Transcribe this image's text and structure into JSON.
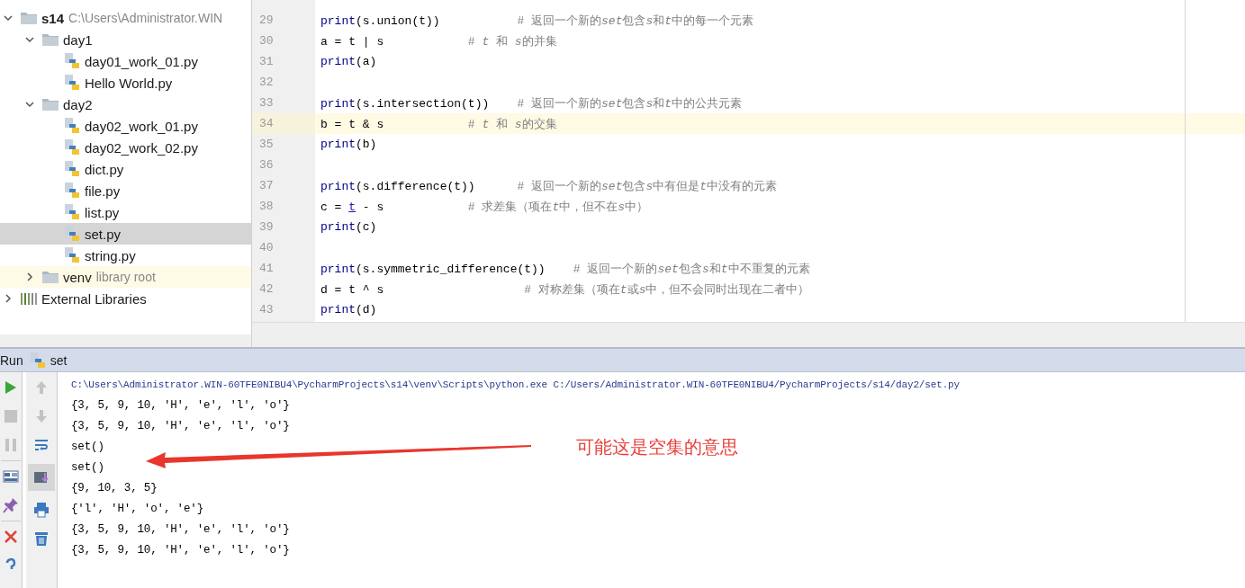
{
  "project_tree": [
    {
      "label": "s14",
      "kind": "folder",
      "bold": true,
      "detail": "C:\\Users\\Administrator.WIN",
      "expanded": true,
      "selected": false,
      "excluded": false,
      "children": [
        {
          "label": "day1",
          "kind": "folder",
          "expanded": true,
          "selected": false,
          "excluded": false,
          "children": [
            {
              "label": "day01_work_01.py",
              "kind": "file",
              "selected": false
            },
            {
              "label": "Hello World.py",
              "kind": "file",
              "selected": false
            }
          ]
        },
        {
          "label": "day2",
          "kind": "folder",
          "expanded": true,
          "selected": false,
          "excluded": false,
          "children": [
            {
              "label": "day02_work_01.py",
              "kind": "file",
              "selected": false
            },
            {
              "label": "day02_work_02.py",
              "kind": "file",
              "selected": false
            },
            {
              "label": "dict.py",
              "kind": "file",
              "selected": false
            },
            {
              "label": "file.py",
              "kind": "file",
              "selected": false
            },
            {
              "label": "list.py",
              "kind": "file",
              "selected": false
            },
            {
              "label": "set.py",
              "kind": "file",
              "selected": true
            },
            {
              "label": "string.py",
              "kind": "file",
              "selected": false
            }
          ]
        },
        {
          "label": "venv",
          "kind": "folder",
          "detail": "library root",
          "expanded": false,
          "selected": false,
          "excluded": true
        }
      ]
    },
    {
      "label": "External Libraries",
      "kind": "library",
      "expanded": false,
      "selected": false,
      "excluded": false
    }
  ],
  "editor": {
    "lines": [
      {
        "number": "29",
        "current": false,
        "tokens": [
          {
            "kind": "builtin",
            "text": "print"
          },
          {
            "kind": "plain",
            "text": "(s.union(t))           "
          },
          {
            "kind": "comment",
            "text": "# 返回一个新的"
          },
          {
            "kind": "comment_var",
            "text": "set"
          },
          {
            "kind": "comment",
            "text": "包含"
          },
          {
            "kind": "comment_var",
            "text": "s"
          },
          {
            "kind": "comment",
            "text": "和"
          },
          {
            "kind": "comment_var",
            "text": "t"
          },
          {
            "kind": "comment",
            "text": "中的每一个元素"
          }
        ]
      },
      {
        "number": "30",
        "current": false,
        "tokens": [
          {
            "kind": "plain",
            "text": "a = t | s            "
          },
          {
            "kind": "comment",
            "text": "# "
          },
          {
            "kind": "comment_var",
            "text": "t"
          },
          {
            "kind": "comment",
            "text": " 和 "
          },
          {
            "kind": "comment_var",
            "text": "s"
          },
          {
            "kind": "comment",
            "text": "的并集"
          }
        ]
      },
      {
        "number": "31",
        "current": false,
        "tokens": [
          {
            "kind": "builtin",
            "text": "print"
          },
          {
            "kind": "plain",
            "text": "(a)"
          }
        ]
      },
      {
        "number": "32",
        "current": false
      },
      {
        "number": "33",
        "current": false,
        "tokens": [
          {
            "kind": "builtin",
            "text": "print"
          },
          {
            "kind": "plain",
            "text": "(s.intersection(t))    "
          },
          {
            "kind": "comment",
            "text": "# 返回一个新的"
          },
          {
            "kind": "comment_var",
            "text": "set"
          },
          {
            "kind": "comment",
            "text": "包含"
          },
          {
            "kind": "comment_var",
            "text": "s"
          },
          {
            "kind": "comment",
            "text": "和"
          },
          {
            "kind": "comment_var",
            "text": "t"
          },
          {
            "kind": "comment",
            "text": "中的公共元素"
          }
        ]
      },
      {
        "number": "34",
        "current": true,
        "tokens": [
          {
            "kind": "plain",
            "text": "b = t & s            "
          },
          {
            "kind": "comment",
            "text": "# "
          },
          {
            "kind": "comment_var",
            "text": "t"
          },
          {
            "kind": "comment",
            "text": " 和 "
          },
          {
            "kind": "comment_var",
            "text": "s"
          },
          {
            "kind": "comment",
            "text": "的交集"
          }
        ]
      },
      {
        "number": "35",
        "current": false,
        "tokens": [
          {
            "kind": "builtin",
            "text": "print"
          },
          {
            "kind": "plain",
            "text": "(b)"
          }
        ]
      },
      {
        "number": "36",
        "current": false
      },
      {
        "number": "37",
        "current": false,
        "tokens": [
          {
            "kind": "builtin",
            "text": "print"
          },
          {
            "kind": "plain",
            "text": "(s.difference(t))      "
          },
          {
            "kind": "comment",
            "text": "# 返回一个新的"
          },
          {
            "kind": "comment_var",
            "text": "set"
          },
          {
            "kind": "comment",
            "text": "包含"
          },
          {
            "kind": "comment_var",
            "text": "s"
          },
          {
            "kind": "comment",
            "text": "中有但是"
          },
          {
            "kind": "comment_var",
            "text": "t"
          },
          {
            "kind": "comment",
            "text": "中没有的元素"
          }
        ]
      },
      {
        "number": "38",
        "current": false,
        "tokens": [
          {
            "kind": "plain",
            "text": "c = "
          },
          {
            "kind": "reference",
            "text": "t"
          },
          {
            "kind": "plain",
            "text": " - s            "
          },
          {
            "kind": "comment",
            "text": "# 求差集（项在"
          },
          {
            "kind": "comment_var",
            "text": "t"
          },
          {
            "kind": "comment",
            "text": "中，但不在"
          },
          {
            "kind": "comment_var",
            "text": "s"
          },
          {
            "kind": "comment",
            "text": "中）"
          }
        ]
      },
      {
        "number": "39",
        "current": false,
        "tokens": [
          {
            "kind": "builtin",
            "text": "print"
          },
          {
            "kind": "plain",
            "text": "(c)"
          }
        ]
      },
      {
        "number": "40",
        "current": false
      },
      {
        "number": "41",
        "current": false,
        "tokens": [
          {
            "kind": "builtin",
            "text": "print"
          },
          {
            "kind": "plain",
            "text": "(s.symmetric_difference(t))    "
          },
          {
            "kind": "comment",
            "text": "# 返回一个新的"
          },
          {
            "kind": "comment_var",
            "text": "set"
          },
          {
            "kind": "comment",
            "text": "包含"
          },
          {
            "kind": "comment_var",
            "text": "s"
          },
          {
            "kind": "comment",
            "text": "和"
          },
          {
            "kind": "comment_var",
            "text": "t"
          },
          {
            "kind": "comment",
            "text": "中不重复的元素"
          }
        ]
      },
      {
        "number": "42",
        "current": false,
        "tokens": [
          {
            "kind": "plain",
            "text": "d = t ^ s                    "
          },
          {
            "kind": "comment",
            "text": "# 对称差集（项在"
          },
          {
            "kind": "comment_var",
            "text": "t"
          },
          {
            "kind": "comment",
            "text": "或"
          },
          {
            "kind": "comment_var",
            "text": "s"
          },
          {
            "kind": "comment",
            "text": "中，但不会同时出现在二者中）"
          }
        ]
      },
      {
        "number": "43",
        "current": false,
        "tokens": [
          {
            "kind": "builtin",
            "text": "print"
          },
          {
            "kind": "plain",
            "text": "(d)"
          }
        ]
      }
    ]
  },
  "run_panel": {
    "title": "Run",
    "tab": "set",
    "toolbar_left": [
      {
        "kind": "run",
        "disabled": false
      },
      {
        "kind": "stop",
        "disabled": true
      },
      {
        "kind": "pause",
        "disabled": true
      },
      {
        "kind": "layout",
        "disabled": false
      },
      {
        "kind": "pin",
        "disabled": false
      },
      {
        "kind": "close",
        "disabled": false
      },
      {
        "kind": "help",
        "disabled": false
      }
    ],
    "toolbar_right": [
      {
        "kind": "up",
        "disabled": true,
        "selected": false
      },
      {
        "kind": "down",
        "disabled": true,
        "selected": false
      },
      {
        "kind": "wrap",
        "disabled": false,
        "selected": false
      },
      {
        "kind": "scroll",
        "disabled": false,
        "selected": true
      },
      {
        "kind": "print",
        "disabled": false,
        "selected": false
      },
      {
        "kind": "trash",
        "disabled": false,
        "selected": false
      }
    ],
    "output": [
      {
        "kind": "command",
        "text": "C:\\Users\\Administrator.WIN-60TFE0NIBU4\\PycharmProjects\\s14\\venv\\Scripts\\python.exe C:/Users/Administrator.WIN-60TFE0NIBU4/PycharmProjects/s14/day2/set.py"
      },
      {
        "kind": "output",
        "text": "{3, 5, 9, 10, 'H', 'e', 'l', 'o'}"
      },
      {
        "kind": "output",
        "text": "{3, 5, 9, 10, 'H', 'e', 'l', 'o'}"
      },
      {
        "kind": "output",
        "text": "set()"
      },
      {
        "kind": "output",
        "text": "set()"
      },
      {
        "kind": "output",
        "text": "{9, 10, 3, 5}"
      },
      {
        "kind": "output",
        "text": "{'l', 'H', 'o', 'e'}"
      },
      {
        "kind": "output",
        "text": "{3, 5, 9, 10, 'H', 'e', 'l', 'o'}"
      },
      {
        "kind": "output",
        "text": "{3, 5, 9, 10, 'H', 'e', 'l', 'o'}"
      }
    ]
  },
  "annotation": {
    "text": "可能这是空集的意思"
  }
}
